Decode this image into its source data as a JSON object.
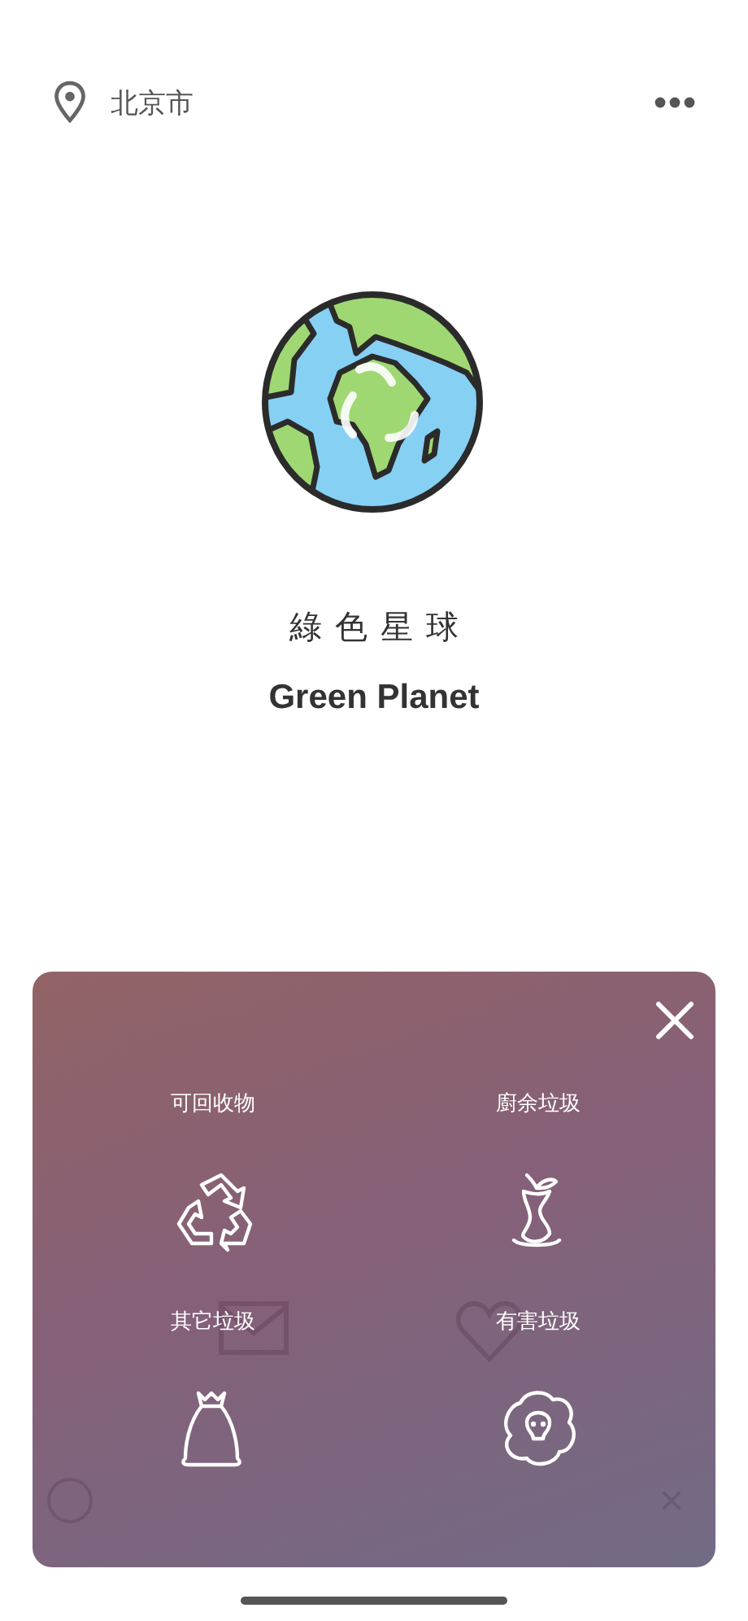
{
  "header": {
    "location": "北京市"
  },
  "app": {
    "title_zh": "綠色星球",
    "title_en": "Green Planet"
  },
  "category_panel": {
    "categories": [
      {
        "label": "可回收物",
        "kind": "recyclable"
      },
      {
        "label": "廚余垃圾",
        "kind": "kitchen"
      },
      {
        "label": "其它垃圾",
        "kind": "other"
      },
      {
        "label": "有害垃圾",
        "kind": "hazardous"
      }
    ]
  }
}
